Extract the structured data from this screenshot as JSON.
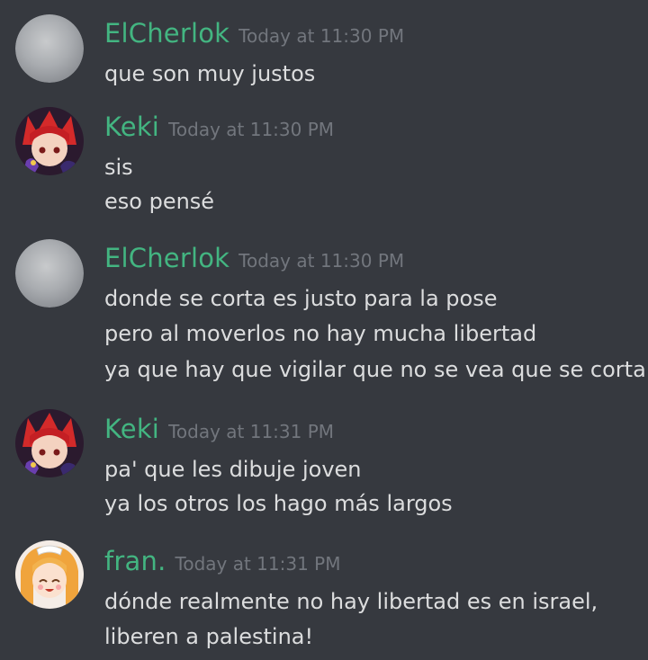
{
  "colors": {
    "background": "#36393f",
    "username": "#43b581",
    "timestamp": "#72767d",
    "message_text": "#dcddde"
  },
  "messages": [
    {
      "author": "ElCherlok",
      "timestamp": "Today at 11:30 PM",
      "avatar": "blurred-gray-avatar",
      "lines": [
        "que son muy justos"
      ]
    },
    {
      "author": "Keki",
      "timestamp": "Today at 11:30 PM",
      "avatar": "red-haired-anime-avatar",
      "lines": [
        "sis",
        "eso pensé"
      ]
    },
    {
      "author": "ElCherlok",
      "timestamp": "Today at 11:30 PM",
      "avatar": "blurred-gray-avatar",
      "lines": [
        "donde se corta es justo para la pose",
        "pero al moverlos no hay mucha libertad",
        "ya que hay que vigilar que no se vea que se corta"
      ]
    },
    {
      "author": "Keki",
      "timestamp": "Today at 11:31 PM",
      "avatar": "red-haired-anime-avatar",
      "lines": [
        "pa' que les dibuje joven",
        "ya los otros los hago más largos"
      ]
    },
    {
      "author": "fran.",
      "timestamp": "Today at 11:31 PM",
      "avatar": "blonde-maid-anime-avatar",
      "lines": [
        "dónde realmente no hay libertad es en israel,",
        "liberen a palestina!"
      ]
    }
  ]
}
